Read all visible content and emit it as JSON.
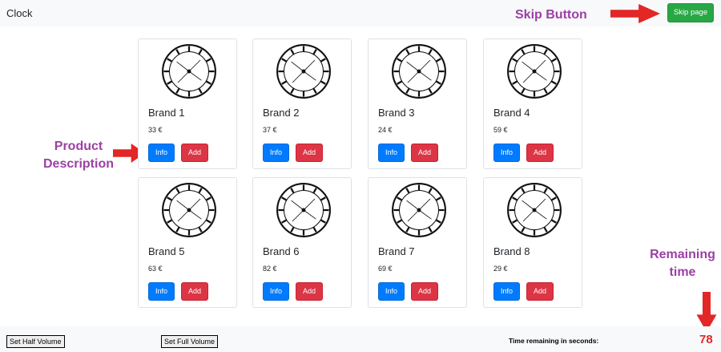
{
  "header": {
    "title": "Clock",
    "skip_label": "Skip page"
  },
  "annotations": {
    "skip": "Skip Button",
    "product_line1": "Product",
    "product_line2": "Description",
    "remaining_line1": "Remaining",
    "remaining_line2": "time"
  },
  "products": [
    {
      "name": "Brand 1",
      "price": "33 €",
      "info": "Info",
      "add": "Add"
    },
    {
      "name": "Brand 2",
      "price": "37 €",
      "info": "Info",
      "add": "Add"
    },
    {
      "name": "Brand 3",
      "price": "24 €",
      "info": "Info",
      "add": "Add"
    },
    {
      "name": "Brand 4",
      "price": "59 €",
      "info": "Info",
      "add": "Add"
    },
    {
      "name": "Brand 5",
      "price": "63 €",
      "info": "Info",
      "add": "Add"
    },
    {
      "name": "Brand 6",
      "price": "82 €",
      "info": "Info",
      "add": "Add"
    },
    {
      "name": "Brand 7",
      "price": "69 €",
      "info": "Info",
      "add": "Add"
    },
    {
      "name": "Brand 8",
      "price": "29 €",
      "info": "Info",
      "add": "Add"
    }
  ],
  "footer": {
    "half_volume": "Set Half Volume",
    "full_volume": "Set Full Volume",
    "time_label": "Time remaining in seconds:",
    "time_value": "78"
  },
  "colors": {
    "skip_button": "#28a745",
    "info_button": "#007bff",
    "add_button": "#dc3545",
    "annotation": "#9b3fa5",
    "arrow": "#e32626"
  },
  "icons": {
    "product_image": "clock-icon",
    "pointer": "arrow-icon"
  }
}
